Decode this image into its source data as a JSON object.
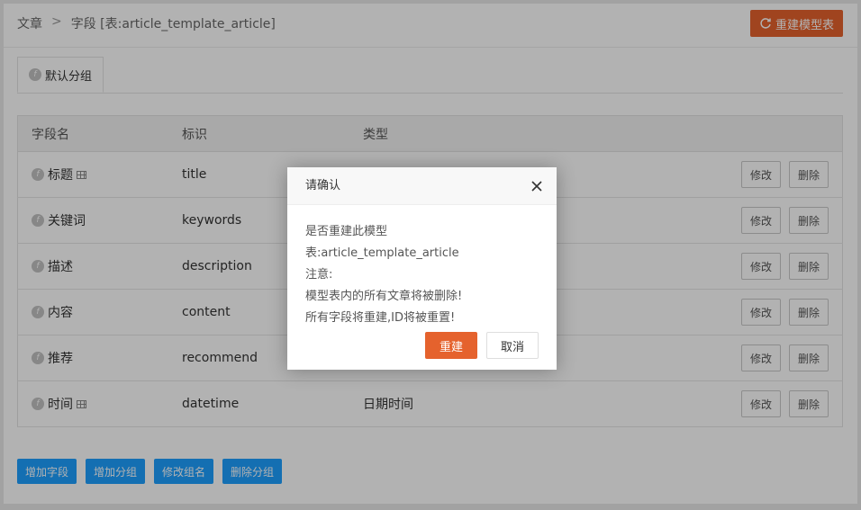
{
  "breadcrumb": {
    "root": "文章",
    "separator": ">",
    "current": "字段 [表:article_template_article]"
  },
  "toolbar": {
    "rebuild_label": "重建模型表"
  },
  "tabs": [
    {
      "label": "默认分组"
    }
  ],
  "table": {
    "headers": [
      "字段名",
      "标识",
      "类型"
    ],
    "rows": [
      {
        "name": "标题",
        "key": "title",
        "type": "",
        "grid": true
      },
      {
        "name": "关键词",
        "key": "keywords",
        "type": "",
        "grid": false
      },
      {
        "name": "描述",
        "key": "description",
        "type": "",
        "grid": false
      },
      {
        "name": "内容",
        "key": "content",
        "type": "",
        "grid": false
      },
      {
        "name": "推荐",
        "key": "recommend",
        "type": "",
        "grid": false
      },
      {
        "name": "时间",
        "key": "datetime",
        "type": "日期时间",
        "grid": true
      }
    ],
    "edit_label": "修改",
    "delete_label": "删除"
  },
  "bottom_actions": [
    "增加字段",
    "增加分组",
    "修改组名",
    "删除分组"
  ],
  "dialog": {
    "title": "请确认",
    "lines": [
      "是否重建此模型表:article_template_article",
      "注意:",
      "模型表内的所有文章将被删除!",
      "所有字段将重建,ID将被重置!"
    ],
    "confirm_label": "重建",
    "cancel_label": "取消"
  },
  "colors": {
    "accent": "#e5622d",
    "blue": "#1e9fff"
  }
}
